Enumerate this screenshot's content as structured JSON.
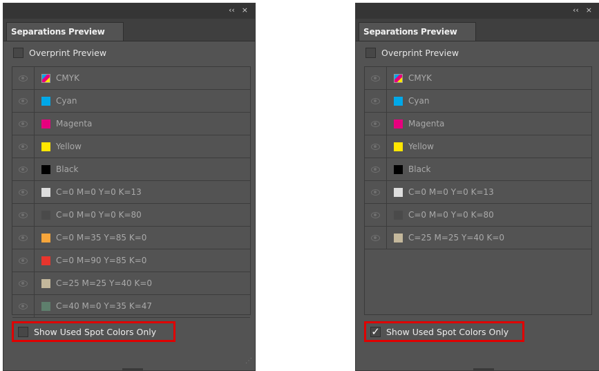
{
  "panel_left": {
    "title_icons": [
      "collapse-icon",
      "close-icon"
    ],
    "collapse_glyph": "‹‹",
    "close_glyph": "×",
    "tab_label": "Separations Preview",
    "overprint": {
      "label": "Overprint Preview",
      "checked": false
    },
    "inks": [
      {
        "name": "CMYK",
        "color": "cmyk"
      },
      {
        "name": "Cyan",
        "color": "#00a8e8"
      },
      {
        "name": "Magenta",
        "color": "#e6007e"
      },
      {
        "name": "Yellow",
        "color": "#ffe600"
      },
      {
        "name": "Black",
        "color": "#000000"
      },
      {
        "name": "C=0 M=0 Y=0 K=13",
        "color": "#dedede"
      },
      {
        "name": "C=0 M=0 Y=0 K=80",
        "color": "#4a4a4a"
      },
      {
        "name": "C=0 M=35 Y=85 K=0",
        "color": "#f7a63b"
      },
      {
        "name": "C=0 M=90 Y=85 K=0",
        "color": "#e8352d"
      },
      {
        "name": "C=25 M=25 Y=40 K=0",
        "color": "#c4b89c"
      },
      {
        "name": "C=40 M=0 Y=35 K=47",
        "color": "#5e7f6d"
      }
    ],
    "show_used_spot": {
      "label": "Show Used Spot Colors Only",
      "checked": false
    }
  },
  "panel_right": {
    "title_icons": [
      "collapse-icon",
      "close-icon"
    ],
    "collapse_glyph": "‹‹",
    "close_glyph": "×",
    "tab_label": "Separations Preview",
    "overprint": {
      "label": "Overprint Preview",
      "checked": false
    },
    "inks": [
      {
        "name": "CMYK",
        "color": "cmyk"
      },
      {
        "name": "Cyan",
        "color": "#00a8e8"
      },
      {
        "name": "Magenta",
        "color": "#e6007e"
      },
      {
        "name": "Yellow",
        "color": "#ffe600"
      },
      {
        "name": "Black",
        "color": "#000000"
      },
      {
        "name": "C=0 M=0 Y=0 K=13",
        "color": "#dedede"
      },
      {
        "name": "C=0 M=0 Y=0 K=80",
        "color": "#4a4a4a"
      },
      {
        "name": "C=25 M=25 Y=40 K=0",
        "color": "#c4b89c"
      }
    ],
    "show_used_spot": {
      "label": "Show Used Spot Colors Only",
      "checked": true,
      "check_glyph": "✓"
    }
  },
  "highlight_color": "#e00000"
}
